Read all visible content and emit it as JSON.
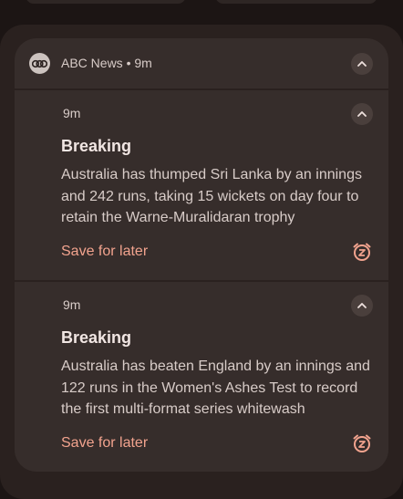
{
  "group": {
    "app_name": "ABC News",
    "separator": "•",
    "time": "9m"
  },
  "notifications": [
    {
      "time": "9m",
      "title": "Breaking",
      "body": "Australia has thumped Sri Lanka by an innings and 242 runs, taking 15 wickets on day four to retain the Warne-Muralidaran trophy",
      "action": "Save for later"
    },
    {
      "time": "9m",
      "title": "Breaking",
      "body": "Australia has beaten England by an innings and 122 runs in the Women's Ashes Test to record the first multi-format series whitewash",
      "action": "Save for later"
    }
  ],
  "icons": {
    "app": "abc-logo-icon",
    "expand": "chevron-up-icon",
    "snooze": "alarm-snooze-icon"
  },
  "colors": {
    "background": "#1c1514",
    "card": "#362d2b",
    "accent": "#f2a38e",
    "text": "#d8ccc8"
  }
}
